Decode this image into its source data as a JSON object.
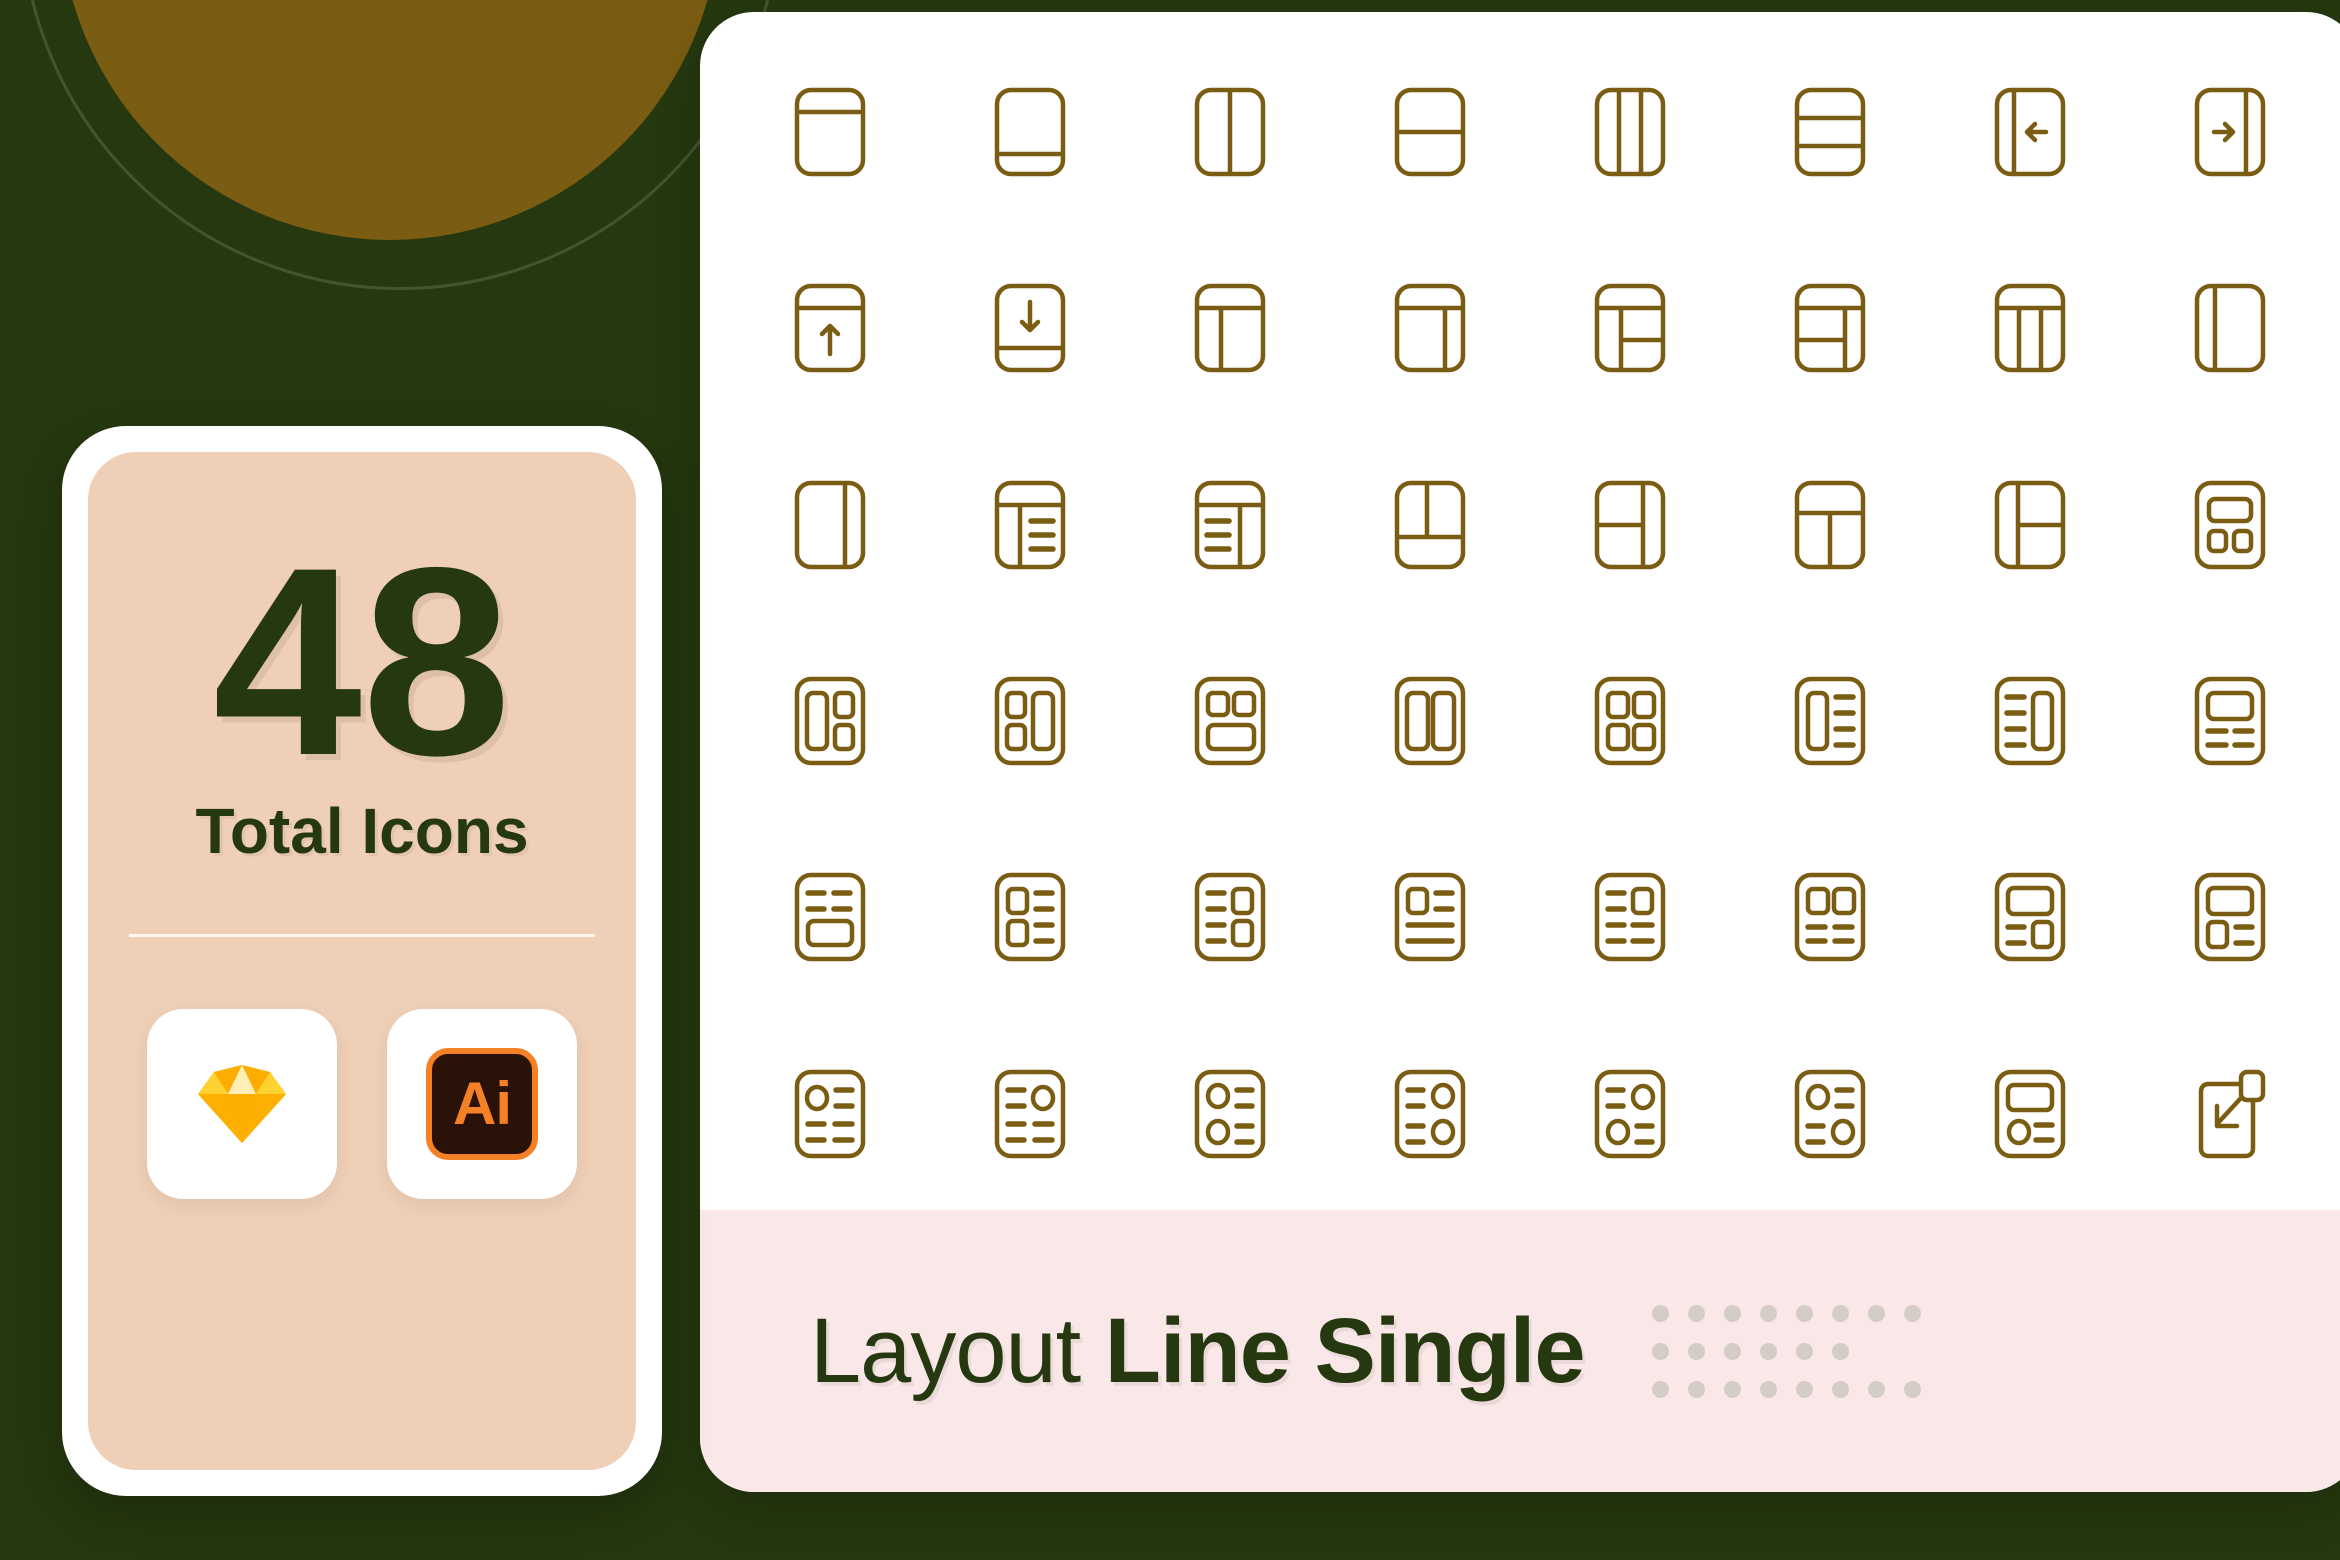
{
  "theme": {
    "background": "#25380F",
    "blob": "#7A5C12",
    "panel": "#FFFFFF",
    "banner": "#FAE7E8",
    "card": "#EFCFB6",
    "icon_stroke": "#7A5C12",
    "text_dark": "#25380F",
    "dot": "#D4CCC6"
  },
  "stat_card": {
    "count": "48",
    "label": "Total Icons",
    "apps": [
      {
        "name": "Sketch",
        "icon": "sketch-diamond-icon"
      },
      {
        "name": "Adobe Illustrator",
        "icon": "adobe-illustrator-icon",
        "badge_text": "Ai"
      }
    ]
  },
  "banner": {
    "title_light": "Layout",
    "title_bold": "Line Single",
    "dot_grid": {
      "rows": 3,
      "columns": 8
    }
  },
  "icon_set": {
    "style": "line-single",
    "category": "Layout",
    "rows": 6,
    "columns": 8,
    "total": 48,
    "icons": [
      {
        "name": "layout-header-bar-icon"
      },
      {
        "name": "layout-footer-bar-icon"
      },
      {
        "name": "layout-two-columns-icon"
      },
      {
        "name": "layout-two-rows-icon"
      },
      {
        "name": "layout-three-columns-icon"
      },
      {
        "name": "layout-three-rows-icon"
      },
      {
        "name": "layout-sidebar-collapse-left-icon"
      },
      {
        "name": "layout-sidebar-collapse-right-icon"
      },
      {
        "name": "layout-header-arrow-up-icon"
      },
      {
        "name": "layout-footer-arrow-down-icon"
      },
      {
        "name": "layout-header-with-left-sidebar-icon"
      },
      {
        "name": "layout-header-with-right-sidebar-icon"
      },
      {
        "name": "layout-header-sidebar-split-left-icon"
      },
      {
        "name": "layout-header-split-right-sidebar-icon"
      },
      {
        "name": "layout-header-three-columns-icon"
      },
      {
        "name": "layout-narrow-left-sidebar-icon"
      },
      {
        "name": "layout-narrow-right-sidebar-icon"
      },
      {
        "name": "layout-header-list-right-icon"
      },
      {
        "name": "layout-header-list-left-icon"
      },
      {
        "name": "layout-two-columns-footer-icon"
      },
      {
        "name": "layout-left-split-right-column-icon"
      },
      {
        "name": "layout-header-bottom-split-icon"
      },
      {
        "name": "layout-left-column-right-split-icon"
      },
      {
        "name": "layout-cards-one-plus-two-icon"
      },
      {
        "name": "layout-tall-left-two-right-icon"
      },
      {
        "name": "layout-two-left-tall-right-icon"
      },
      {
        "name": "layout-two-top-wide-bottom-icon"
      },
      {
        "name": "layout-two-tall-columns-icon"
      },
      {
        "name": "layout-four-cards-grid-icon"
      },
      {
        "name": "layout-tall-card-left-lines-right-icon"
      },
      {
        "name": "layout-lines-left-tall-card-right-icon"
      },
      {
        "name": "layout-wide-card-lines-below-icon"
      },
      {
        "name": "layout-lines-top-wide-card-icon"
      },
      {
        "name": "layout-card-left-lines-right-icon"
      },
      {
        "name": "layout-lines-left-cards-right-icon"
      },
      {
        "name": "layout-card-lines-stacked-icon"
      },
      {
        "name": "layout-lines-card-right-icon"
      },
      {
        "name": "layout-two-cards-lines-below-icon"
      },
      {
        "name": "layout-wide-card-line-card-icon"
      },
      {
        "name": "layout-wide-card-card-lines-icon"
      },
      {
        "name": "layout-avatar-left-lines-icon"
      },
      {
        "name": "layout-lines-avatar-right-icon"
      },
      {
        "name": "layout-two-avatars-left-icon"
      },
      {
        "name": "layout-lines-two-avatars-right-icon"
      },
      {
        "name": "layout-lines-avatar-mixed-icon"
      },
      {
        "name": "layout-avatar-lines-mixed-icon"
      },
      {
        "name": "layout-card-avatar-lines-icon"
      },
      {
        "name": "layout-external-window-arrow-icon"
      }
    ]
  }
}
